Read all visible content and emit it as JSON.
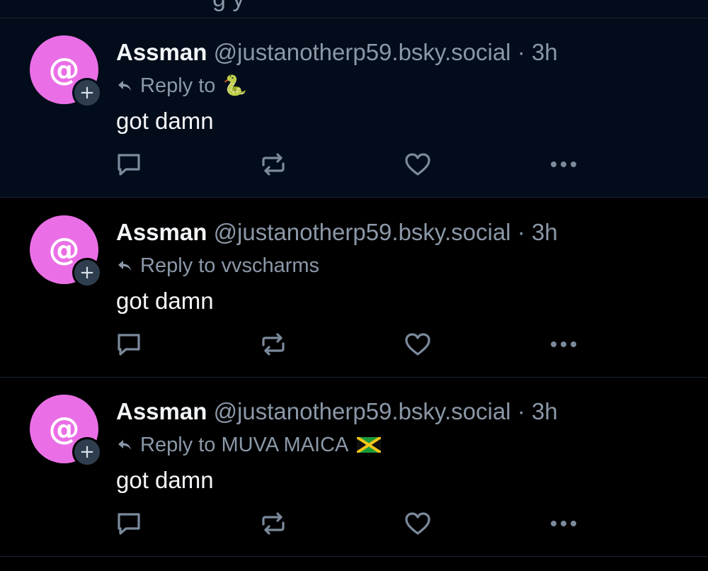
{
  "feed": {
    "top_cut_text": "g y",
    "posts": [
      {
        "display_name": "Assman",
        "handle": "@justanotherp59.bsky.social",
        "separator": "·",
        "time": "3h",
        "reply_label": "Reply to",
        "reply_target": "",
        "reply_emoji": "🐍",
        "text": "got damn",
        "avatar_glyph": "@",
        "follow_glyph": "+",
        "highlighted": true
      },
      {
        "display_name": "Assman",
        "handle": "@justanotherp59.bsky.social",
        "separator": "·",
        "time": "3h",
        "reply_label": "Reply to",
        "reply_target": "vvscharms",
        "text": "got damn",
        "avatar_glyph": "@",
        "follow_glyph": "+",
        "highlighted": false
      },
      {
        "display_name": "Assman",
        "handle": "@justanotherp59.bsky.social",
        "separator": "·",
        "time": "3h",
        "reply_label": "Reply to",
        "reply_target": "MUVA MAICA",
        "reply_flag": "jamaica-flag-icon",
        "text": "got damn",
        "avatar_glyph": "@",
        "follow_glyph": "+",
        "highlighted": false
      }
    ]
  },
  "icons": {
    "reply": "speech-bubble-icon",
    "repost": "repost-arrows-icon",
    "like": "heart-icon",
    "more": "ellipsis-icon",
    "reply_to": "reply-arrow-icon"
  },
  "colors": {
    "background": "#000000",
    "highlight_background": "#020c1a",
    "avatar": "#ea6fe6",
    "muted_text": "#8b98a8",
    "icon": "#7b8a9c",
    "divider": "#1c2633"
  }
}
